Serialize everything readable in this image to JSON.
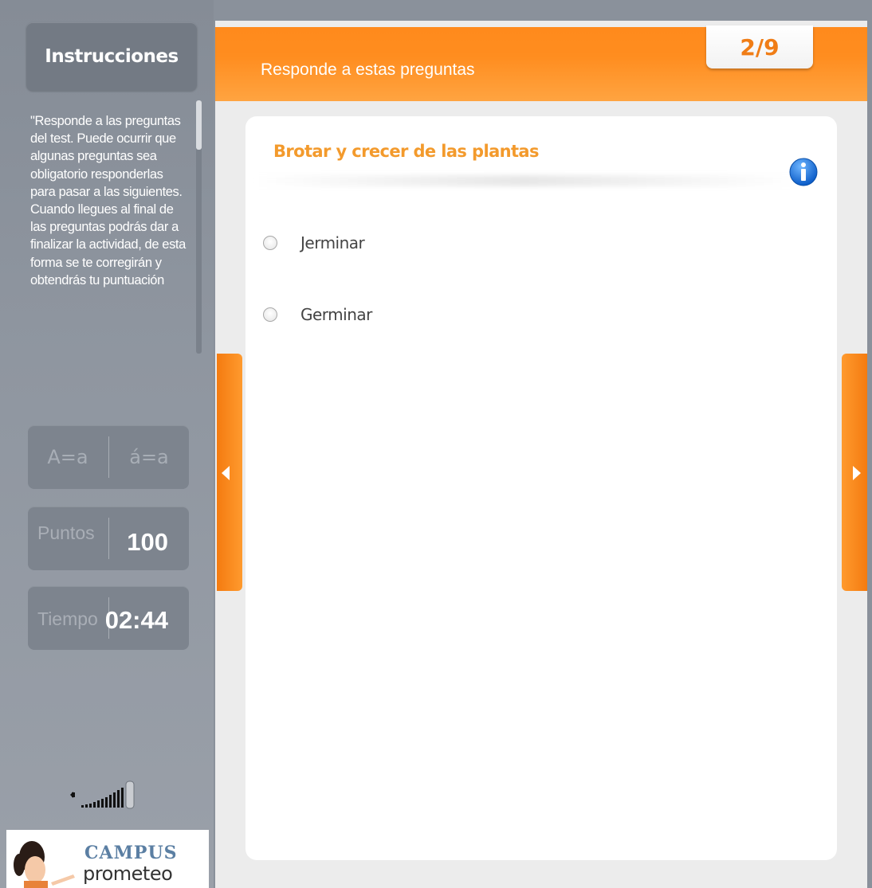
{
  "sidebar": {
    "instructions_title": "Instrucciones",
    "instructions_text": "\"Responde a las preguntas del test. Puede ocurrir que algunas preguntas sea obligatorio responderlas para pasar a las siguientes. Cuando llegues al final de las preguntas podrás dar a finalizar la actividad, de esta forma se te corregirán y obtendrás tu puntuación",
    "case_option_1": "A=a",
    "case_option_2": "á=a",
    "points_label": "Puntos",
    "points_value": "100",
    "time_label": "Tiempo",
    "time_value": "02:44",
    "logo_campus": "CAMPUS",
    "logo_prometeo": "prometeo"
  },
  "header": {
    "title": "Responde a estas preguntas",
    "counter": "2/9"
  },
  "question": {
    "title": "Brotar y crecer de las plantas",
    "options": [
      "Jerminar",
      "Germinar"
    ]
  },
  "icons": {
    "info": "info-icon",
    "prev": "left-arrow-icon",
    "next": "right-arrow-icon",
    "volume": "volume-icon"
  },
  "colors": {
    "accent_orange": "#ff8a1c",
    "title_orange": "#f39a2c",
    "sidebar_gray": "#8a919b"
  }
}
